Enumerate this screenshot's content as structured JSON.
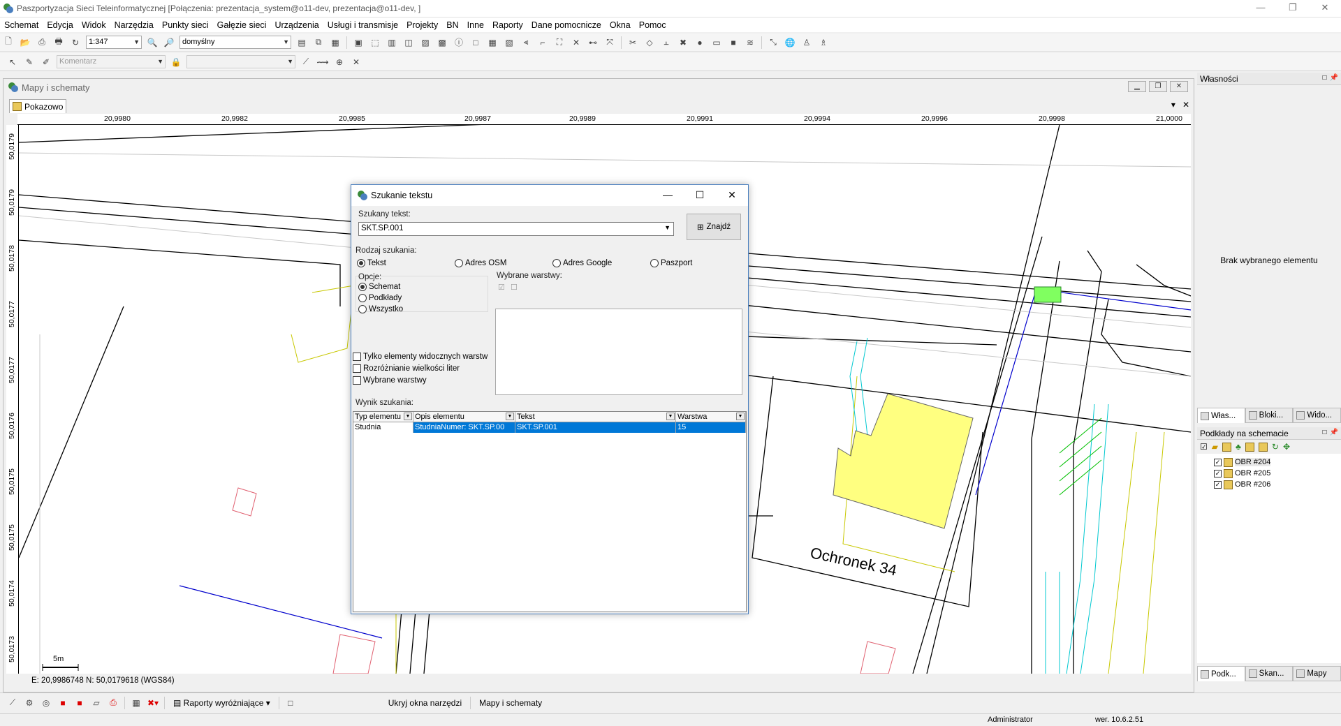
{
  "window": {
    "title": "Paszportyzacja Sieci Teleinformatycznej [Połączenia: prezentacja_system@o11-dev, prezentacja@o11-dev, ]"
  },
  "menu": [
    "Schemat",
    "Edycja",
    "Widok",
    "Narzędzia",
    "Punkty sieci",
    "Gałęzie sieci",
    "Urządzenia",
    "Usługi i transmisje",
    "Projekty",
    "BN",
    "Inne",
    "Raporty",
    "Dane pomocnicze",
    "Okna",
    "Pomoc"
  ],
  "toolbar": {
    "scale_value": "1:347",
    "style_value": "domyślny",
    "comment_placeholder": "Komentarz"
  },
  "mdi": {
    "title": "Mapy i schematy",
    "tab_label": "Pokazowo",
    "top_ruler": [
      "20,9980",
      "20,9982",
      "20,9985",
      "20,9987",
      "20,9989",
      "20,9991",
      "20,9994",
      "20,9996",
      "20,9998",
      "21,0000"
    ],
    "left_ruler": [
      "50,0179",
      "50,0179",
      "50,0178",
      "50,0177",
      "50,0177",
      "50,0176",
      "50,0175",
      "50,0175",
      "50,0174",
      "50,0173"
    ],
    "scale_bar": "5m",
    "map_label": "Ochronek 34",
    "coords": "E: 20,9986748  N: 50,0179618 (WGS84)"
  },
  "dialog": {
    "title": "Szukanie tekstu",
    "search_label": "Szukany tekst:",
    "search_value": "SKT.SP.001",
    "find_button": "Znajdź",
    "search_type_label": "Rodzaj szukania:",
    "search_types": [
      "Tekst",
      "Adres OSM",
      "Adres Google",
      "Paszport"
    ],
    "options_label": "Opcje:",
    "options": [
      "Schemat",
      "Podkłady",
      "Wszystko"
    ],
    "layers_label": "Wybrane warstwy:",
    "checkboxes": [
      "Tylko elementy widocznych warstw",
      "Rozróżnianie wielkości liter",
      "Wybrane warstwy"
    ],
    "results_label": "Wynik szukania:",
    "columns": [
      "Typ elementu",
      "Opis elementu",
      "Tekst",
      "Warstwa"
    ],
    "rows": [
      {
        "type": "Studnia",
        "desc": "StudniaNumer: SKT.SP.00",
        "text": "SKT.SP.001",
        "layer": "15"
      }
    ]
  },
  "right_panel": {
    "properties_title": "Własności",
    "empty_text": "Brak wybranego elementu",
    "top_tabs": [
      "Włas...",
      "Bloki...",
      "Wido..."
    ],
    "layers_title": "Podkłady na schemacie",
    "layers": [
      "OBR #204",
      "OBR #205",
      "OBR #206"
    ],
    "bottom_tabs": [
      "Podk...",
      "Skan...",
      "Mapy"
    ]
  },
  "bottombar": {
    "reports": "Raporty wyróżniające",
    "hide_tools": "Ukryj okna narzędzi",
    "maps": "Mapy i schematy"
  },
  "status": {
    "user": "Administrator",
    "version": "wer. 10.6.2.51"
  },
  "colors": {
    "selection": "#0078d7",
    "building_fill": "#ffff80",
    "well_fill": "#80ff60"
  }
}
